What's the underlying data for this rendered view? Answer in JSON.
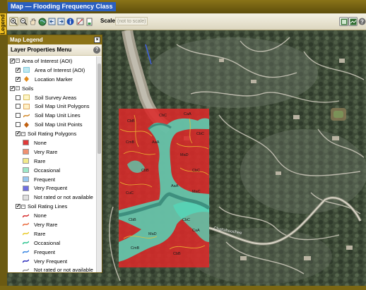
{
  "window": {
    "title": "Map — Flooding Frequency Class",
    "side_tab": "Legend"
  },
  "toolbar": {
    "icons": [
      "zoom-in-icon",
      "zoom-out-icon",
      "pan-icon",
      "full-extent-icon",
      "back-icon",
      "forward-icon",
      "identify-icon",
      "measure-icon",
      "print-icon"
    ],
    "scale_label": "Scale",
    "scale_value": "(not to scale)",
    "right_icons": [
      "map-view-icon",
      "map-layers-icon",
      "help-icon"
    ]
  },
  "legend": {
    "title": "Map Legend",
    "menu_title": "Layer Properties Menu",
    "rows": [
      {
        "label": "Area of Interest (AOI)",
        "checked": true,
        "indent": 0,
        "type": "group"
      },
      {
        "label": "Area of Interest (AOI)",
        "checked": true,
        "indent": 1,
        "type": "area",
        "color": "#bfe8f0",
        "border": "#7cc8dc"
      },
      {
        "label": "Location Marker",
        "checked": true,
        "indent": 1,
        "type": "marker",
        "color": "#e08a1c"
      },
      {
        "label": "Soils",
        "checked": true,
        "indent": 0,
        "type": "group"
      },
      {
        "label": "Soil Survey Areas",
        "checked": false,
        "indent": 1,
        "type": "area",
        "color": "#fff6c8",
        "border": "#d8c060"
      },
      {
        "label": "Soil Map Unit Polygons",
        "checked": false,
        "indent": 1,
        "type": "area",
        "color": "#fff2c8",
        "border": "#e0a860"
      },
      {
        "label": "Soil Map Unit Lines",
        "checked": false,
        "indent": 1,
        "type": "line",
        "color": "#d0821c"
      },
      {
        "label": "Soil Map Unit Points",
        "checked": false,
        "indent": 1,
        "type": "marker",
        "color": "#c06010"
      },
      {
        "label": "Soil Rating Polygons",
        "checked": true,
        "indent": 1,
        "type": "group"
      },
      {
        "label": "None",
        "indent": 2,
        "type": "area",
        "color": "#e03a3a"
      },
      {
        "label": "Very Rare",
        "indent": 2,
        "type": "area",
        "color": "#f09070"
      },
      {
        "label": "Rare",
        "indent": 2,
        "type": "area",
        "color": "#f2ea8a"
      },
      {
        "label": "Occasional",
        "indent": 2,
        "type": "area",
        "color": "#9ee8c8"
      },
      {
        "label": "Frequent",
        "indent": 2,
        "type": "area",
        "color": "#98c8f0"
      },
      {
        "label": "Very Frequent",
        "indent": 2,
        "type": "area",
        "color": "#6f6ee0"
      },
      {
        "label": "Not rated or not available",
        "indent": 2,
        "type": "area",
        "color": "#e0e0e0"
      },
      {
        "label": "Soil Rating Lines",
        "checked": true,
        "indent": 1,
        "type": "group"
      },
      {
        "label": "None",
        "indent": 2,
        "type": "line",
        "color": "#d42020"
      },
      {
        "label": "Very Rare",
        "indent": 2,
        "type": "line",
        "color": "#e86030"
      },
      {
        "label": "Rare",
        "indent": 2,
        "type": "line",
        "color": "#e8c820"
      },
      {
        "label": "Occasional",
        "indent": 2,
        "type": "line",
        "color": "#22c08a"
      },
      {
        "label": "Frequent",
        "indent": 2,
        "type": "line",
        "color": "#2c7ee0"
      },
      {
        "label": "Very Frequent",
        "indent": 2,
        "type": "line",
        "color": "#2020b8"
      },
      {
        "label": "Not rated or not available",
        "indent": 2,
        "type": "line",
        "color": "#909090"
      }
    ]
  },
  "map": {
    "road_label": "Chattahoochee",
    "unit_labels": [
      "CbB",
      "CbC",
      "CaA",
      "CmB",
      "MaD",
      "CbB",
      "CbC",
      "AaA",
      "CuC",
      "MaC",
      "CbB",
      "CbC",
      "MaD",
      "CaA",
      "CmB",
      "CbB",
      "AaA",
      "CbC"
    ]
  }
}
